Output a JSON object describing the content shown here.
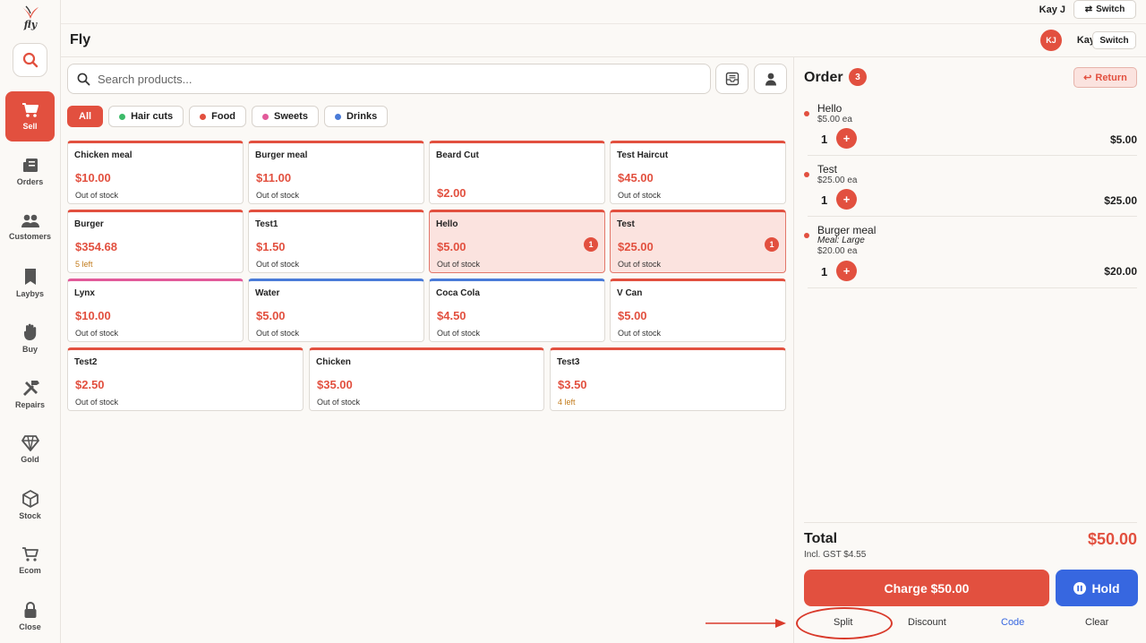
{
  "app": {
    "logo_text": "fly",
    "store_name": "Fly"
  },
  "user": {
    "name_top": "Kay J",
    "initials": "KJ",
    "name": "Kay",
    "switch_label": "Switch"
  },
  "sidebar": {
    "items": [
      {
        "label": "Sell",
        "icon": "cart-icon",
        "active": true
      },
      {
        "label": "Orders",
        "icon": "orders-icon"
      },
      {
        "label": "Customers",
        "icon": "customers-icon"
      },
      {
        "label": "Laybys",
        "icon": "bookmark-icon"
      },
      {
        "label": "Buy",
        "icon": "hand-icon"
      },
      {
        "label": "Repairs",
        "icon": "tools-icon"
      },
      {
        "label": "Gold",
        "icon": "diamond-icon"
      },
      {
        "label": "Stock",
        "icon": "box-icon"
      },
      {
        "label": "Ecom",
        "icon": "ecom-cart-icon"
      },
      {
        "label": "Close",
        "icon": "lock-icon"
      }
    ]
  },
  "search": {
    "placeholder": "Search products..."
  },
  "filters": [
    {
      "label": "All",
      "active": true
    },
    {
      "label": "Hair cuts",
      "color": "#3dbb6a"
    },
    {
      "label": "Food",
      "color": "#e2503f"
    },
    {
      "label": "Sweets",
      "color": "#e25a9a"
    },
    {
      "label": "Drinks",
      "color": "#4a7bd8"
    }
  ],
  "products": [
    {
      "name": "Chicken meal",
      "price": "$10.00",
      "stock": "Out of stock"
    },
    {
      "name": "Burger meal",
      "price": "$11.00",
      "stock": "Out of stock"
    },
    {
      "name": "Beard Cut",
      "price": "$2.00",
      "stock": ""
    },
    {
      "name": "Test Haircut",
      "price": "$45.00",
      "stock": "Out of stock"
    },
    {
      "name": "Burger",
      "price": "$354.68",
      "stock": "5 left"
    },
    {
      "name": "Test1",
      "price": "$1.50",
      "stock": "Out of stock"
    },
    {
      "name": "Hello",
      "price": "$5.00",
      "stock": "Out of stock",
      "qty": "1"
    },
    {
      "name": "Test",
      "price": "$25.00",
      "stock": "Out of stock",
      "qty": "1"
    },
    {
      "name": "Lynx",
      "price": "$10.00",
      "stock": "Out of stock"
    },
    {
      "name": "Water",
      "price": "$5.00",
      "stock": "Out of stock"
    },
    {
      "name": "Coca Cola",
      "price": "$4.50",
      "stock": "Out of stock"
    },
    {
      "name": "V Can",
      "price": "$5.00",
      "stock": "Out of stock"
    },
    {
      "name": "Test2",
      "price": "$2.50",
      "stock": "Out of stock"
    },
    {
      "name": "Chicken",
      "price": "$35.00",
      "stock": "Out of stock"
    },
    {
      "name": "Test3",
      "price": "$3.50",
      "stock": "4 left"
    }
  ],
  "order": {
    "title": "Order",
    "count": "3",
    "return_label": "Return",
    "lines": [
      {
        "name": "Hello",
        "unit": "$5.00 ea",
        "qty": "1",
        "total": "$5.00"
      },
      {
        "name": "Test",
        "unit": "$25.00 ea",
        "qty": "1",
        "total": "$25.00"
      },
      {
        "name": "Burger meal",
        "modifier": "Meal: Large",
        "unit": "$20.00 ea",
        "qty": "1",
        "total": "$20.00"
      }
    ],
    "plus_label": "+",
    "total_label": "Total",
    "gst": "Incl. GST $4.55",
    "total": "$50.00",
    "charge_label": "Charge $50.00",
    "hold_label": "Hold",
    "actions": {
      "split": "Split",
      "discount": "Discount",
      "code": "Code",
      "clear": "Clear"
    }
  }
}
